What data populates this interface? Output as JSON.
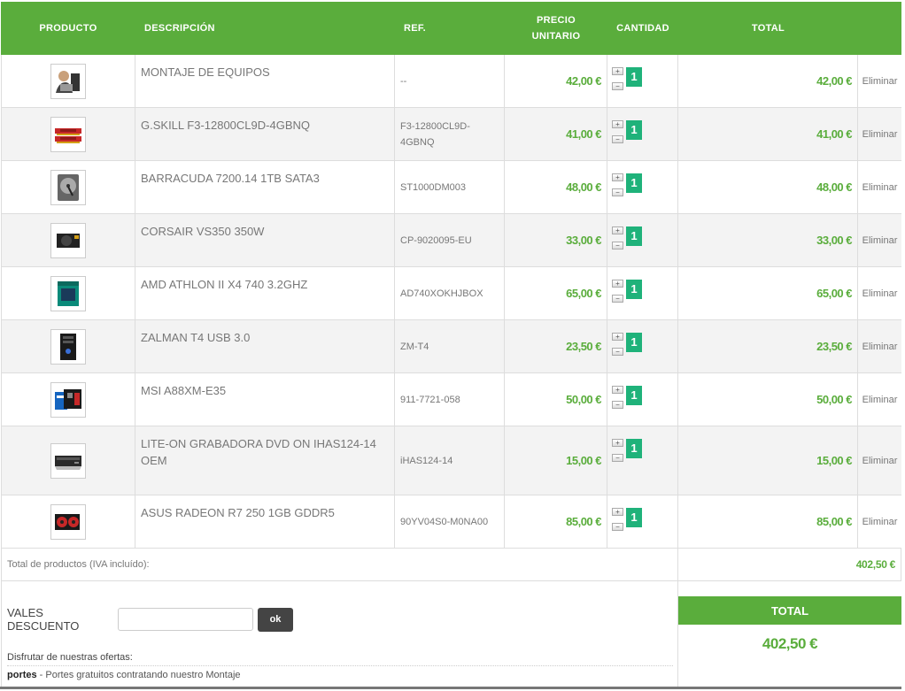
{
  "header": {
    "producto": "PRODUCTO",
    "descripcion": "DESCRIPCIÓN",
    "ref": "REF.",
    "precio_l1": "PRECIO",
    "precio_l2": "UNITARIO",
    "cantidad": "CANTIDAD",
    "total": "TOTAL"
  },
  "rows": [
    {
      "desc": "MONTAJE DE EQUIPOS",
      "ref": "--",
      "unit": "42,00 €",
      "qty": "1",
      "total": "42,00 €",
      "del": "Eliminar",
      "icon": "technician-icon"
    },
    {
      "desc": "G.SKILL F3-12800CL9D-4GBNQ",
      "ref": "F3-12800CL9D-4GBNQ",
      "unit": "41,00 €",
      "qty": "1",
      "total": "41,00 €",
      "del": "Eliminar",
      "icon": "ram-icon"
    },
    {
      "desc": "BARRACUDA 7200.14 1TB SATA3",
      "ref": "ST1000DM003",
      "unit": "48,00 €",
      "qty": "1",
      "total": "48,00 €",
      "del": "Eliminar",
      "icon": "hard-drive-icon"
    },
    {
      "desc": "CORSAIR VS350 350W",
      "ref": "CP-9020095-EU",
      "unit": "33,00 €",
      "qty": "1",
      "total": "33,00 €",
      "del": "Eliminar",
      "icon": "power-supply-icon"
    },
    {
      "desc": "AMD ATHLON II X4 740 3.2GHZ",
      "ref": "AD740XOKHJBOX",
      "unit": "65,00 €",
      "qty": "1",
      "total": "65,00 €",
      "del": "Eliminar",
      "icon": "cpu-box-icon"
    },
    {
      "desc": "ZALMAN T4 USB 3.0",
      "ref": "ZM-T4",
      "unit": "23,50 €",
      "qty": "1",
      "total": "23,50 €",
      "del": "Eliminar",
      "icon": "pc-case-icon"
    },
    {
      "desc": "MSI A88XM-E35",
      "ref": "911-7721-058",
      "unit": "50,00 €",
      "qty": "1",
      "total": "50,00 €",
      "del": "Eliminar",
      "icon": "motherboard-icon"
    },
    {
      "desc": "LITE-ON GRABADORA DVD ON IHAS124-14 OEM",
      "ref": "iHAS124-14",
      "unit": "15,00 €",
      "qty": "1",
      "total": "15,00 €",
      "del": "Eliminar",
      "icon": "dvd-drive-icon"
    },
    {
      "desc": "ASUS RADEON R7 250 1GB GDDR5",
      "ref": "90YV04S0-M0NA00",
      "unit": "85,00 €",
      "qty": "1",
      "total": "85,00 €",
      "del": "Eliminar",
      "icon": "graphics-card-icon"
    }
  ],
  "qty_plus": "+",
  "qty_minus": "−",
  "subtotal": {
    "label": "Total de productos (IVA incluído):",
    "value": "402,50 €"
  },
  "voucher": {
    "label": "VALES DESCUENTO",
    "placeholder": "",
    "button": "ok"
  },
  "offers": {
    "title": "Disfrutar de nuestras ofertas:",
    "item_bold": "portes",
    "item_text": " - Portes gratuitos contratando nuestro Montaje"
  },
  "total": {
    "label": "TOTAL",
    "value": "402,50 €"
  },
  "colors": {
    "accent": "#5aad3c",
    "qty": "#1fb27a",
    "button": "#444444"
  }
}
